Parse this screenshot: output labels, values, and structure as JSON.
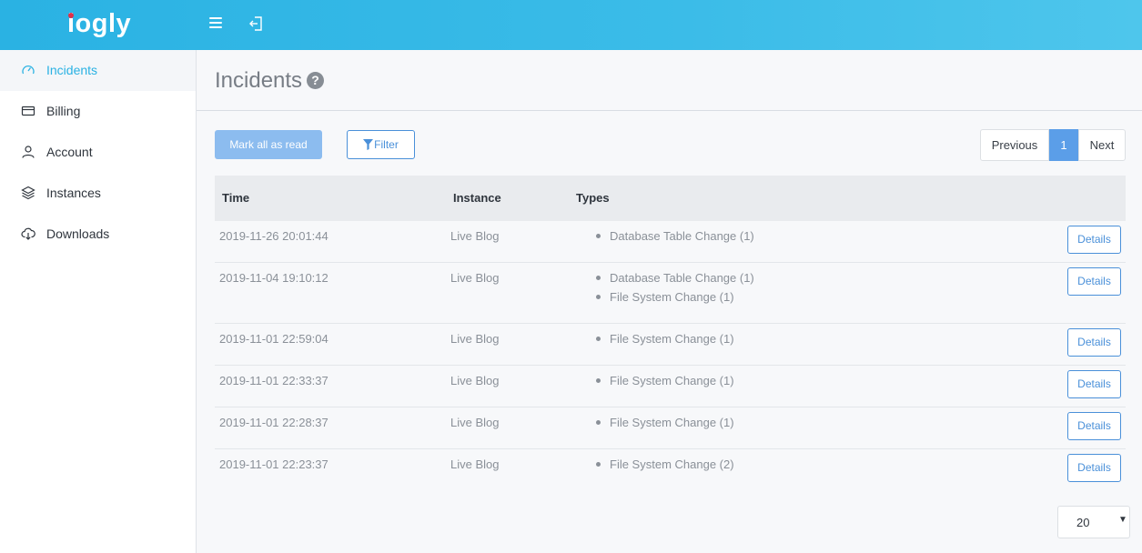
{
  "app": {
    "logo": "iogly"
  },
  "sidebar": {
    "items": [
      {
        "label": "Incidents",
        "icon": "dashboard-gauge-icon",
        "active": true
      },
      {
        "label": "Billing",
        "icon": "credit-card-icon",
        "active": false
      },
      {
        "label": "Account",
        "icon": "user-icon",
        "active": false
      },
      {
        "label": "Instances",
        "icon": "layers-icon",
        "active": false
      },
      {
        "label": "Downloads",
        "icon": "cloud-download-icon",
        "active": false
      }
    ]
  },
  "page": {
    "title": "Incidents",
    "help_icon": "question-circle-icon"
  },
  "toolbar": {
    "mark_all_label": "Mark all as read",
    "filter_label": "Filter"
  },
  "pagination": {
    "prev_label": "Previous",
    "current": "1",
    "next_label": "Next"
  },
  "table": {
    "headers": {
      "time": "Time",
      "instance": "Instance",
      "types": "Types"
    },
    "rows": [
      {
        "time": "2019-11-26 20:01:44",
        "instance": "Live Blog",
        "types": [
          "Database Table Change (1)"
        ],
        "action": "Details"
      },
      {
        "time": "2019-11-04 19:10:12",
        "instance": "Live Blog",
        "types": [
          "Database Table Change (1)",
          "File System Change (1)"
        ],
        "action": "Details"
      },
      {
        "time": "2019-11-01 22:59:04",
        "instance": "Live Blog",
        "types": [
          "File System Change (1)"
        ],
        "action": "Details"
      },
      {
        "time": "2019-11-01 22:33:37",
        "instance": "Live Blog",
        "types": [
          "File System Change (1)"
        ],
        "action": "Details"
      },
      {
        "time": "2019-11-01 22:28:37",
        "instance": "Live Blog",
        "types": [
          "File System Change (1)"
        ],
        "action": "Details"
      },
      {
        "time": "2019-11-01 22:23:37",
        "instance": "Live Blog",
        "types": [
          "File System Change (2)"
        ],
        "action": "Details"
      }
    ]
  },
  "per_page": {
    "value": "20"
  },
  "colors": {
    "accent": "#2ab2e3",
    "primary": "#4a90d9",
    "pager_active": "#5b9ee8"
  }
}
